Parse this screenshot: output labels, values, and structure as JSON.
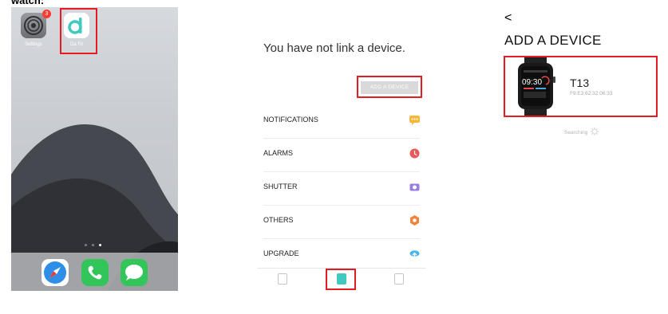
{
  "cut_title": "watch:",
  "home": {
    "settings_label": "Settings",
    "settings_badge": "3",
    "dafit_label": "Da Fit"
  },
  "mid": {
    "title": "You have not link a device.",
    "add_button": "ADD A DEVICE",
    "menu": [
      {
        "label": "NOTIFICATIONS",
        "icon": "chat-icon",
        "color": "#f5b83d"
      },
      {
        "label": "ALARMS",
        "icon": "clock-icon",
        "color": "#e85a5a"
      },
      {
        "label": "SHUTTER",
        "icon": "camera-icon",
        "color": "#9b7de0"
      },
      {
        "label": "OTHERS",
        "icon": "gear-icon",
        "color": "#f0843c"
      },
      {
        "label": "UPGRADE",
        "icon": "cloud-upload-icon",
        "color": "#4ab6e8"
      }
    ]
  },
  "right": {
    "back": "<",
    "title": "ADD A DEVICE",
    "device_name": "T13",
    "device_mac": "F9:E3:62:32:06:33",
    "watch_time": "09:30",
    "searching": "Searching"
  },
  "colors": {
    "highlight": "#e31b23",
    "teal": "#3fc9c0"
  }
}
